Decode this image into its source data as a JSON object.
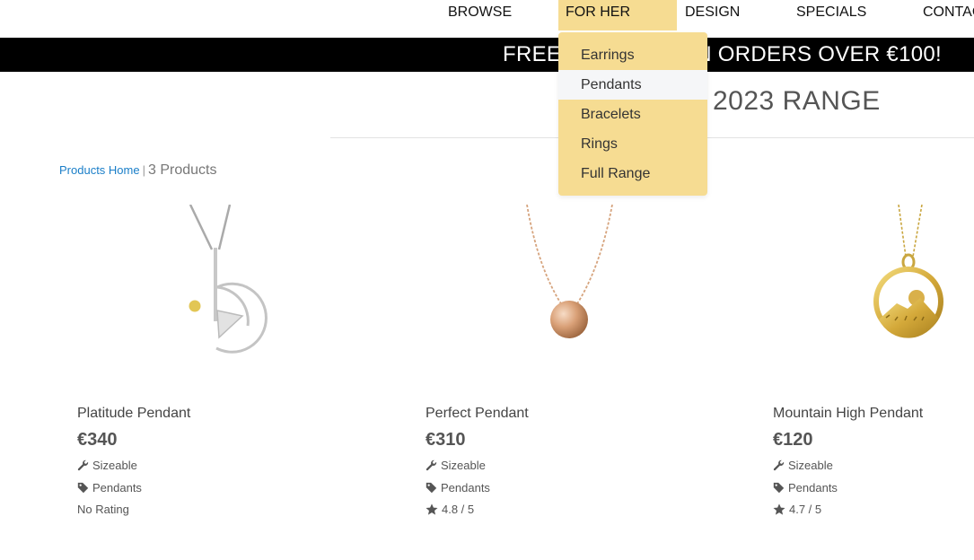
{
  "nav": {
    "items": [
      {
        "label": "BROWSE"
      },
      {
        "label": "FOR HER"
      },
      {
        "label": "DESIGN"
      },
      {
        "label": "SPECIALS"
      },
      {
        "label": "CONTAC"
      }
    ]
  },
  "promo": {
    "text": "FREE SHIPPING ON ORDERS OVER €100!"
  },
  "dropdown": {
    "items": [
      "Earrings",
      "Pendants",
      "Bracelets",
      "Rings",
      "Full Range"
    ]
  },
  "heading": {
    "text": "2023 RANGE"
  },
  "breadcrumb": {
    "home": "Products Home",
    "separator": "|",
    "count": "3 Products"
  },
  "products": [
    {
      "name": "Platitude Pendant",
      "price": "€340",
      "feature": "Sizeable",
      "category": "Pendants",
      "rating": "No Rating"
    },
    {
      "name": "Perfect Pendant",
      "price": "€310",
      "feature": "Sizeable",
      "category": "Pendants",
      "rating": "4.8 / 5"
    },
    {
      "name": "Mountain High Pendant",
      "price": "€120",
      "feature": "Sizeable",
      "category": "Pendants",
      "rating": "4.7 / 5"
    }
  ],
  "colors": {
    "accent": "#f6dc92",
    "promo_bg": "#000000",
    "link": "#1a7ec8"
  }
}
